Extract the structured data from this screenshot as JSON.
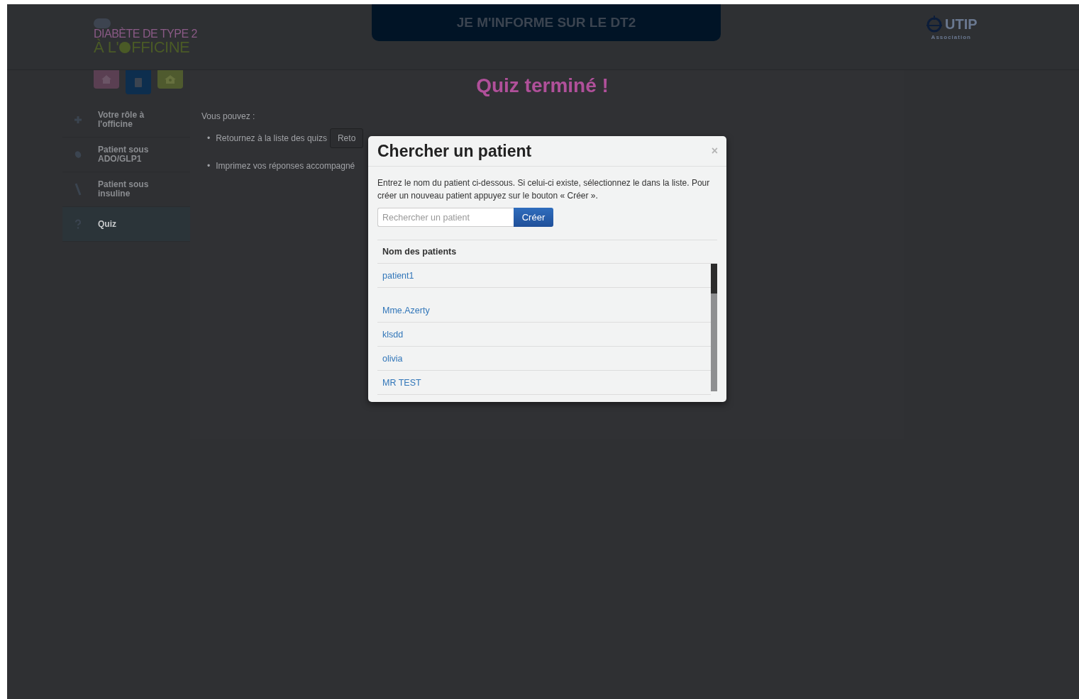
{
  "header": {
    "logo_line1": "DIABÈTE DE TYPE 2",
    "logo_line2_a": "À L'",
    "logo_line2_b": "FFICINE",
    "banner": "JE M'INFORME SUR LE DT2",
    "partner_logo": "UTIP",
    "partner_sub": "Association"
  },
  "icon_tabs": [
    {
      "kind": "home",
      "color": "#5a3f52",
      "selected": false
    },
    {
      "kind": "book",
      "color": "#0d2e4e",
      "selected": true
    },
    {
      "kind": "house",
      "color": "#4f5a2e",
      "selected": false
    }
  ],
  "sidebar": {
    "items": [
      {
        "kind": "plus",
        "label": "Votre rôle à l'officine",
        "selected": false
      },
      {
        "kind": "pill",
        "label": "Patient sous ADO/GLP1",
        "selected": false
      },
      {
        "kind": "pen",
        "label": "Patient sous insuline",
        "selected": false
      },
      {
        "kind": "question",
        "label": "Quiz",
        "selected": true
      }
    ]
  },
  "content": {
    "title": "Quiz terminé !",
    "intro": "Vous pouvez :",
    "bullets": [
      {
        "marker": "•",
        "text": "Retournez à la liste des quizs",
        "button": "Reto"
      },
      {
        "marker": "•",
        "text": "Imprimez vos réponses accompagné"
      }
    ]
  },
  "modal": {
    "title": "Chercher un patient",
    "close": "×",
    "description": "Entrez le nom du patient ci-dessous. Si celui-ci existe, sélectionnez le dans la liste. Pour créer un nouveau patient appuyez sur le bouton « Créer ».",
    "search_placeholder": "Rechercher un patient",
    "create_button": "Créer",
    "column": "Nom des patients",
    "patients": [
      "patient1",
      "Mme.Azerty",
      "klsdd",
      "olivia",
      "MR TEST"
    ]
  }
}
